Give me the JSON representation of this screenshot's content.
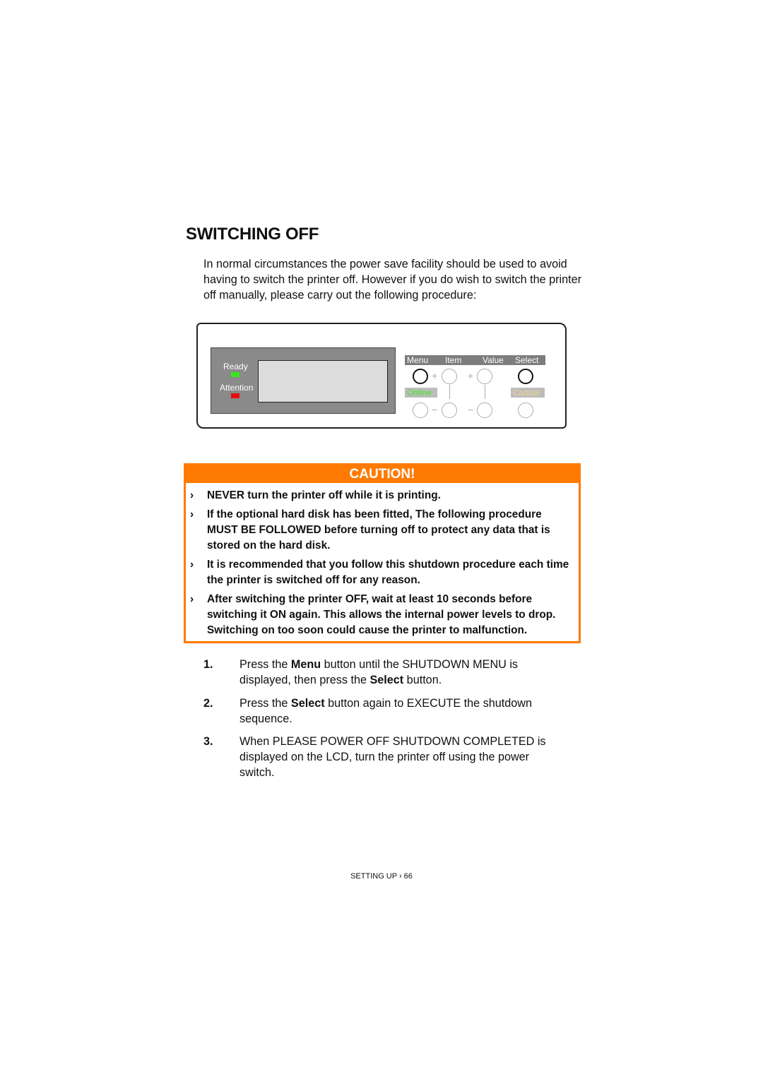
{
  "page": {
    "title": "SWITCHING OFF",
    "intro": "In normal circumstances  the power save facility should be used to avoid having to switch the printer off. However if you do wish to switch the printer off manually, please carry out the following procedure:"
  },
  "panel": {
    "ready_label": "Ready",
    "attention_label": "Attention",
    "ready_led_color": "#39e51c",
    "attention_led_color": "#e01010",
    "keys": {
      "menu": "Menu",
      "item": "Item",
      "value": "Value",
      "select": "Select",
      "online": "Online",
      "cancel": "Cancel",
      "plus": "+",
      "minus": "−"
    }
  },
  "caution": {
    "heading": "CAUTION!",
    "accent_color": "#ff7a00",
    "bullet": "›",
    "items": [
      "NEVER turn the printer off while it is printing.",
      "If the optional hard disk has been fitted, The following procedure MUST BE FOLLOWED before turning off to protect any data that is stored on the hard disk.",
      "It is recommended that you follow this shutdown procedure each time the printer is switched off for any reason.",
      "After switching the printer OFF, wait at least 10 seconds before switching it ON again. This allows the internal power levels to drop. Switching on too soon could cause the printer to malfunction."
    ]
  },
  "steps": [
    {
      "num": "1.",
      "parts": [
        "Press the ",
        "Menu",
        " button until the SHUTDOWN MENU is displayed, then press the ",
        "Select",
        " button."
      ]
    },
    {
      "num": "2.",
      "parts": [
        "Press the ",
        "Select",
        " button again to EXECUTE the shutdown sequence."
      ]
    },
    {
      "num": "3.",
      "text": "When PLEASE POWER OFF SHUTDOWN COMPLETED is displayed on the LCD, turn the printer off using the power switch."
    }
  ],
  "footer": "SETTING UP › 66"
}
